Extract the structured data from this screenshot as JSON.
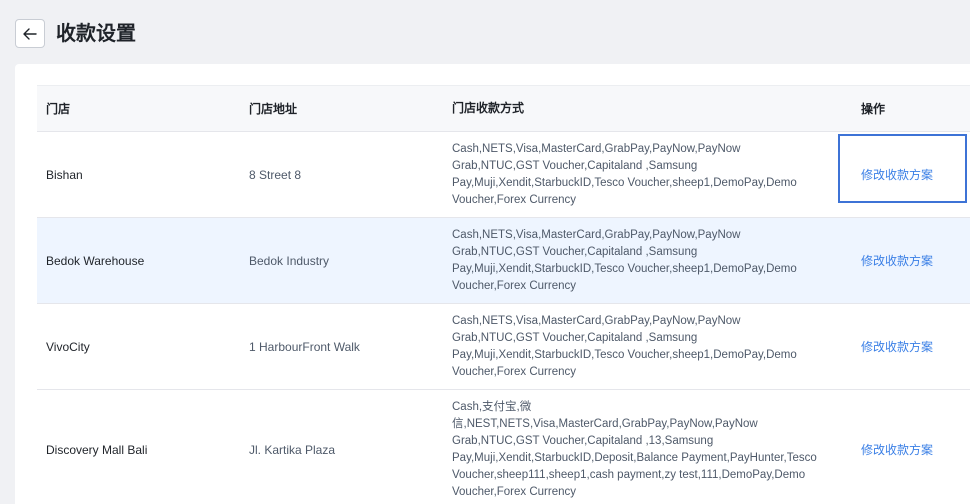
{
  "header": {
    "back_icon": "arrow-left-icon",
    "title": "收款设置"
  },
  "table": {
    "columns": [
      "门店",
      "门店地址",
      "门店收款方式",
      "操作"
    ],
    "rows": [
      {
        "store": "Bishan",
        "address": "8 Street 8",
        "methods": [
          "Cash,NETS,Visa,MasterCard,GrabPay,PayNow,PayNow",
          "Grab,NTUC,GST Voucher,Capitaland ,Samsung",
          "Pay,Muji,Xendit,StarbuckID,Tesco Voucher,sheep1,DemoPay,Demo",
          "Voucher,Forex Currency"
        ],
        "action": "修改收款方案"
      },
      {
        "store": "Bedok Warehouse",
        "address": "Bedok Industry",
        "methods": [
          "Cash,NETS,Visa,MasterCard,GrabPay,PayNow,PayNow",
          "Grab,NTUC,GST Voucher,Capitaland ,Samsung",
          "Pay,Muji,Xendit,StarbuckID,Tesco Voucher,sheep1,DemoPay,Demo",
          "Voucher,Forex Currency"
        ],
        "action": "修改收款方案"
      },
      {
        "store": "VivoCity",
        "address": "1 HarbourFront Walk",
        "methods": [
          "Cash,NETS,Visa,MasterCard,GrabPay,PayNow,PayNow",
          "Grab,NTUC,GST Voucher,Capitaland ,Samsung",
          "Pay,Muji,Xendit,StarbuckID,Tesco Voucher,sheep1,DemoPay,Demo",
          "Voucher,Forex Currency"
        ],
        "action": "修改收款方案"
      },
      {
        "store": "Discovery Mall Bali",
        "address": "Jl. Kartika Plaza",
        "methods": [
          "Cash,支付宝,微",
          "信,NEST,NETS,Visa,MasterCard,GrabPay,PayNow,PayNow",
          "Grab,NTUC,GST Voucher,Capitaland ,13,Samsung",
          "Pay,Muji,Xendit,StarbuckID,Deposit,Balance Payment,PayHunter,Tesco",
          "Voucher,sheep111,sheep1,cash payment,zy test,111,DemoPay,Demo",
          "Voucher,Forex Currency"
        ],
        "action": "修改收款方案"
      }
    ]
  },
  "colors": {
    "link": "#3a7fe6",
    "highlight_row": "#eef5ff",
    "focus_border": "#3d73d6"
  }
}
